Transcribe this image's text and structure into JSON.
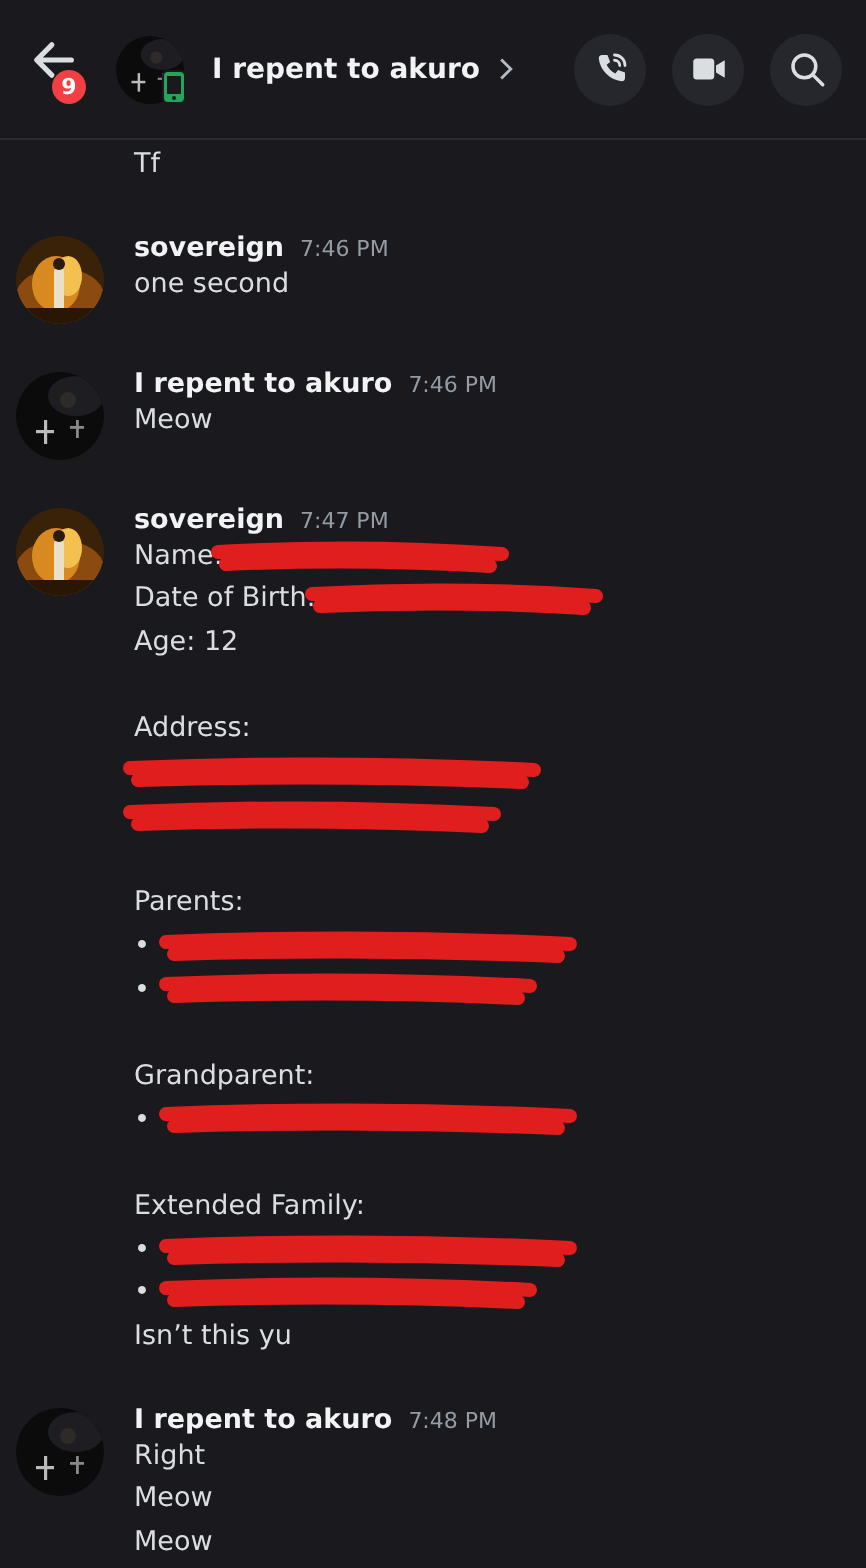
{
  "header": {
    "back_badge": "9",
    "title": "I repent to akuro",
    "on_mobile": true
  },
  "messages": [
    {
      "blocks": [
        [
          {
            "text": "Tf",
            "redacted": false
          }
        ]
      ]
    },
    {
      "author": "sovereign",
      "time": "7:46 PM",
      "blocks": [
        [
          {
            "text": "one second",
            "redacted": false
          }
        ]
      ]
    },
    {
      "author": "I repent to akuro",
      "time": "7:46 PM",
      "blocks": [
        [
          {
            "text": "Meow",
            "redacted": false
          }
        ]
      ]
    },
    {
      "author": "sovereign",
      "time": "7:47 PM",
      "blocks": [
        [
          {
            "text": "Name:",
            "redacted": true
          },
          {
            "text": "Date of Birth:",
            "redacted": true
          },
          {
            "text": "Age: 12",
            "redacted": false
          }
        ],
        [
          {
            "text": "Address:",
            "redacted": false
          },
          {
            "redacted": true
          },
          {
            "redacted": true
          }
        ],
        [
          {
            "text": "Parents:",
            "redacted": false
          },
          {
            "text": "•",
            "redacted": true
          },
          {
            "text": "•",
            "redacted": true
          }
        ],
        [
          {
            "text": "Grandparent:",
            "redacted": false
          },
          {
            "text": "•",
            "redacted": true
          }
        ],
        [
          {
            "text": "Extended Family:",
            "redacted": false
          },
          {
            "text": "•",
            "redacted": true
          },
          {
            "text": "•",
            "redacted": true
          },
          {
            "text": "Isn’t this yu",
            "redacted": false
          }
        ]
      ]
    },
    {
      "author": "I repent to akuro",
      "time": "7:48 PM",
      "blocks": [
        [
          {
            "text": "Right",
            "redacted": false
          },
          {
            "text": "Meow",
            "redacted": false
          },
          {
            "text": "Meow",
            "redacted": false
          }
        ]
      ]
    }
  ]
}
